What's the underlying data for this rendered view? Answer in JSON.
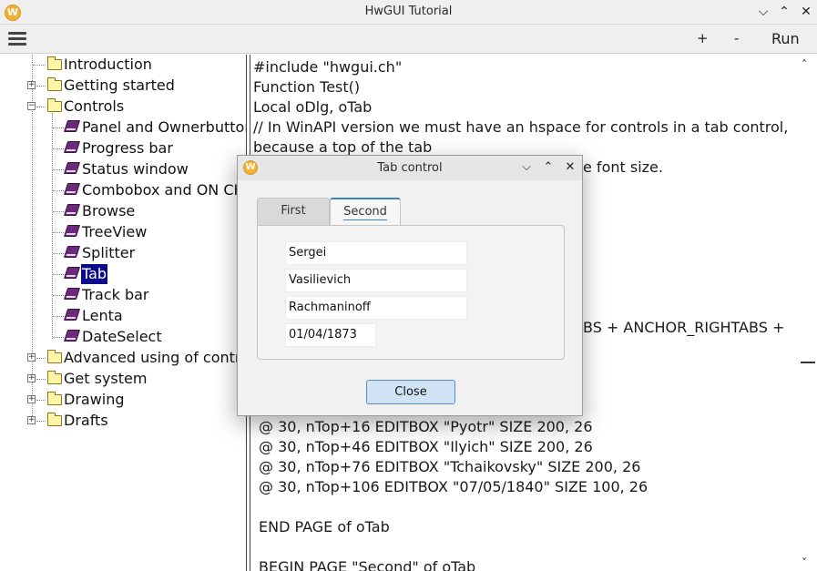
{
  "window": {
    "title": "HwGUI Tutorial",
    "app_icon_letter": "W"
  },
  "toolbar": {
    "plus_label": "+",
    "minus_label": "-",
    "run_label": "Run"
  },
  "tree": {
    "items": [
      {
        "label": "Introduction",
        "kind": "folder",
        "expander": ""
      },
      {
        "label": "Getting started",
        "kind": "folder",
        "expander": "+"
      },
      {
        "label": "Controls",
        "kind": "folder",
        "expander": "−"
      },
      {
        "label": "Panel and Ownerbutton",
        "kind": "book"
      },
      {
        "label": "Progress bar",
        "kind": "book"
      },
      {
        "label": "Status window",
        "kind": "book"
      },
      {
        "label": "Combobox and ON CH",
        "kind": "book"
      },
      {
        "label": "Browse",
        "kind": "book"
      },
      {
        "label": "TreeView",
        "kind": "book"
      },
      {
        "label": "Splitter",
        "kind": "book"
      },
      {
        "label": "Tab",
        "kind": "book",
        "selected": true
      },
      {
        "label": "Track bar",
        "kind": "book"
      },
      {
        "label": "Lenta",
        "kind": "book"
      },
      {
        "label": "DateSelect",
        "kind": "book"
      },
      {
        "label": "Advanced using of contro",
        "kind": "folder",
        "expander": "+"
      },
      {
        "label": "Get system",
        "kind": "folder",
        "expander": "+"
      },
      {
        "label": "Drawing",
        "kind": "folder",
        "expander": "+"
      },
      {
        "label": "Drafts",
        "kind": "folder",
        "expander": "+"
      }
    ]
  },
  "code": {
    "lines": [
      "#include \"hwgui.ch\"",
      "Function Test()",
      "Local oDlg, oTab",
      "// In WinAPI version we must have an hspace for controls in a tab control,",
      "because a top of the tab",
      "e font size.",
      "BS + ANCHOR_RIGHTABS +",
      "  @ 30, nTop+16 EDITBOX \"Pyotr\" SIZE 200, 26",
      "  @ 30, nTop+46 EDITBOX \"Ilyich\" SIZE 200, 26",
      "  @ 30, nTop+76 EDITBOX \"Tchaikovsky\" SIZE 200, 26",
      "  @ 30, nTop+106 EDITBOX \"07/05/1840\" SIZE 100, 26",
      "  END PAGE of oTab",
      "  BEGIN PAGE \"Second\" of oTab"
    ]
  },
  "dialog": {
    "title": "Tab control",
    "tabs": [
      "First",
      "Second"
    ],
    "fields": [
      "Sergei",
      "Vasilievich",
      "Rachmaninoff",
      "01/04/1873"
    ],
    "close_label": "Close"
  },
  "colors": {
    "selection": "#0a0a8a",
    "accent": "#3b82c4",
    "close_button_bg": "#cfe3f5"
  }
}
